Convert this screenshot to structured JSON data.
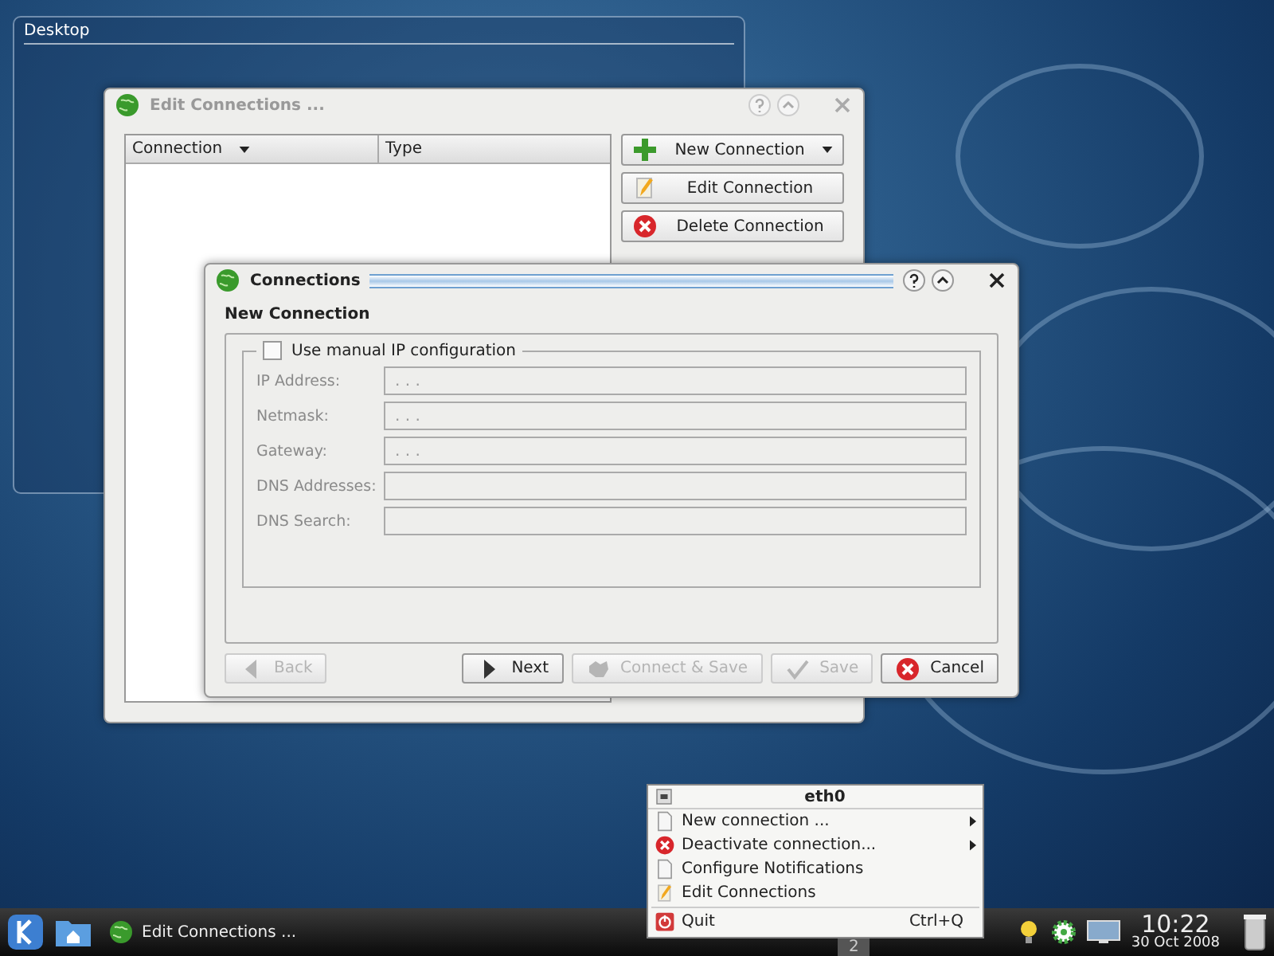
{
  "desktop_widget": {
    "title": "Desktop"
  },
  "edit_window": {
    "title": "Edit Connections ...",
    "active": false,
    "table": {
      "columns": [
        {
          "label": "Connection",
          "sorted": true
        },
        {
          "label": "Type",
          "sorted": false
        }
      ]
    },
    "buttons": [
      {
        "label": "New Connection",
        "dropdown": true
      },
      {
        "label": "Edit Connection",
        "dropdown": false
      },
      {
        "label": "Delete Connection",
        "dropdown": false
      }
    ]
  },
  "dialog": {
    "title": "Connections",
    "active": true,
    "heading": "New Connection",
    "group": {
      "label": "Use manual IP configuration",
      "checked": false,
      "fields": [
        {
          "label": "IP Address:",
          "placeholder": ". . .",
          "disabled": true
        },
        {
          "label": "Netmask:",
          "placeholder": ". . .",
          "disabled": true
        },
        {
          "label": "Gateway:",
          "placeholder": ". . .",
          "disabled": true
        },
        {
          "label": "DNS Addresses:",
          "disabled": true
        },
        {
          "label": "DNS Search:",
          "disabled": true
        }
      ]
    },
    "buttons": [
      {
        "label": "Back",
        "disabled": true
      },
      {
        "label": "Next",
        "disabled": false
      },
      {
        "label": "Connect & Save",
        "disabled": true
      },
      {
        "label": "Save",
        "disabled": true
      },
      {
        "label": "Cancel",
        "disabled": false
      }
    ]
  },
  "menu": {
    "title": "eth0",
    "items": [
      {
        "kind": "item",
        "label": "New connection ...",
        "submenu": true
      },
      {
        "kind": "item",
        "label": "Deactivate connection...",
        "submenu": true
      },
      {
        "kind": "item",
        "label": "Configure Notifications",
        "submenu": false
      },
      {
        "kind": "item",
        "label": "Edit Connections",
        "submenu": false
      },
      {
        "kind": "separator"
      },
      {
        "kind": "item",
        "label": "Quit",
        "submenu": false,
        "shortcut": "Ctrl+Q"
      }
    ]
  },
  "taskbar": {
    "tasks": [
      {
        "label": "Edit Connections ..."
      }
    ],
    "pager": "2",
    "clock": {
      "time": "10:22",
      "date": "30 Oct 2008"
    }
  }
}
